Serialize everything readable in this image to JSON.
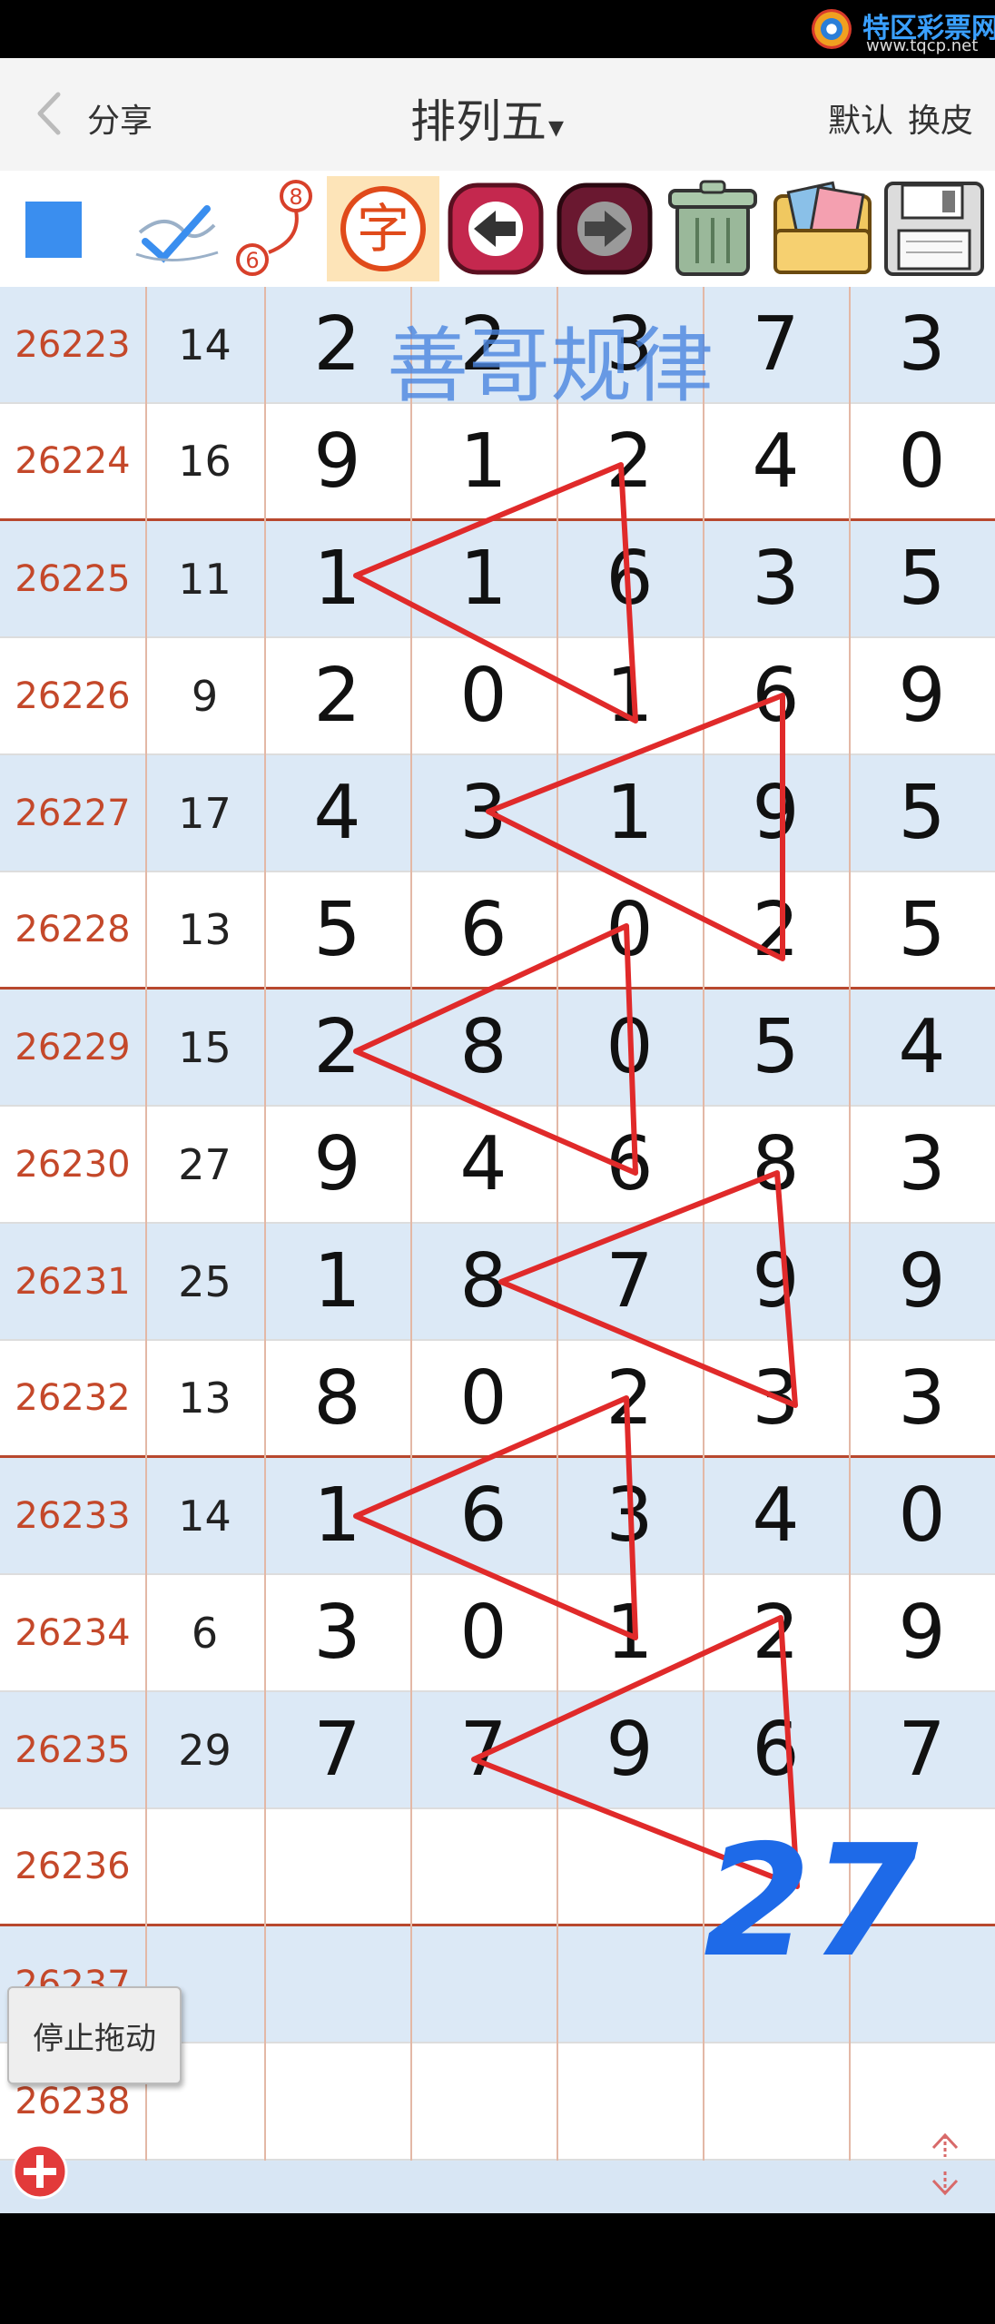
{
  "watermark_site": {
    "name": "特区彩票网",
    "url": "www.tqcp.net"
  },
  "header": {
    "back_label": "分享",
    "title": "排列五",
    "title_caret": "▾",
    "default_label": "默认",
    "skin_label": "换皮"
  },
  "toolbar": {
    "zi_label": "字",
    "path_num_top": "8",
    "path_num_bottom": "6"
  },
  "overlay": {
    "watermark": "善哥规律",
    "handwritten": "27"
  },
  "stop_drag_label": "停止拖动",
  "colors": {
    "period_text": "#c4482a",
    "row_alt": "#dce9f6",
    "accent_blue": "#3a8eef",
    "line_red": "#e02a2a",
    "separator": "#b8482e"
  },
  "rows": [
    {
      "period": "26223",
      "sum": "14",
      "digits": [
        "2",
        "2",
        "3",
        "7",
        "3"
      ]
    },
    {
      "period": "26224",
      "sum": "16",
      "digits": [
        "9",
        "1",
        "2",
        "4",
        "0"
      ]
    },
    {
      "period": "26225",
      "sum": "11",
      "digits": [
        "1",
        "1",
        "6",
        "3",
        "5"
      ]
    },
    {
      "period": "26226",
      "sum": "9",
      "digits": [
        "2",
        "0",
        "1",
        "6",
        "9"
      ]
    },
    {
      "period": "26227",
      "sum": "17",
      "digits": [
        "4",
        "3",
        "1",
        "9",
        "5"
      ]
    },
    {
      "period": "26228",
      "sum": "13",
      "digits": [
        "5",
        "6",
        "0",
        "2",
        "5"
      ]
    },
    {
      "period": "26229",
      "sum": "15",
      "digits": [
        "2",
        "8",
        "0",
        "5",
        "4"
      ]
    },
    {
      "period": "26230",
      "sum": "27",
      "digits": [
        "9",
        "4",
        "6",
        "8",
        "3"
      ]
    },
    {
      "period": "26231",
      "sum": "25",
      "digits": [
        "1",
        "8",
        "7",
        "9",
        "9"
      ]
    },
    {
      "period": "26232",
      "sum": "13",
      "digits": [
        "8",
        "0",
        "2",
        "3",
        "3"
      ]
    },
    {
      "period": "26233",
      "sum": "14",
      "digits": [
        "1",
        "6",
        "3",
        "4",
        "0"
      ]
    },
    {
      "period": "26234",
      "sum": "6",
      "digits": [
        "3",
        "0",
        "1",
        "2",
        "9"
      ]
    },
    {
      "period": "26235",
      "sum": "29",
      "digits": [
        "7",
        "7",
        "9",
        "6",
        "7"
      ]
    },
    {
      "period": "26236",
      "sum": "",
      "digits": [
        "",
        "",
        "",
        "",
        ""
      ]
    },
    {
      "period": "26237",
      "sum": "",
      "digits": [
        "",
        "",
        "",
        "",
        ""
      ]
    },
    {
      "period": "26238",
      "sum": "",
      "digits": [
        "",
        "",
        "",
        "",
        ""
      ]
    }
  ]
}
